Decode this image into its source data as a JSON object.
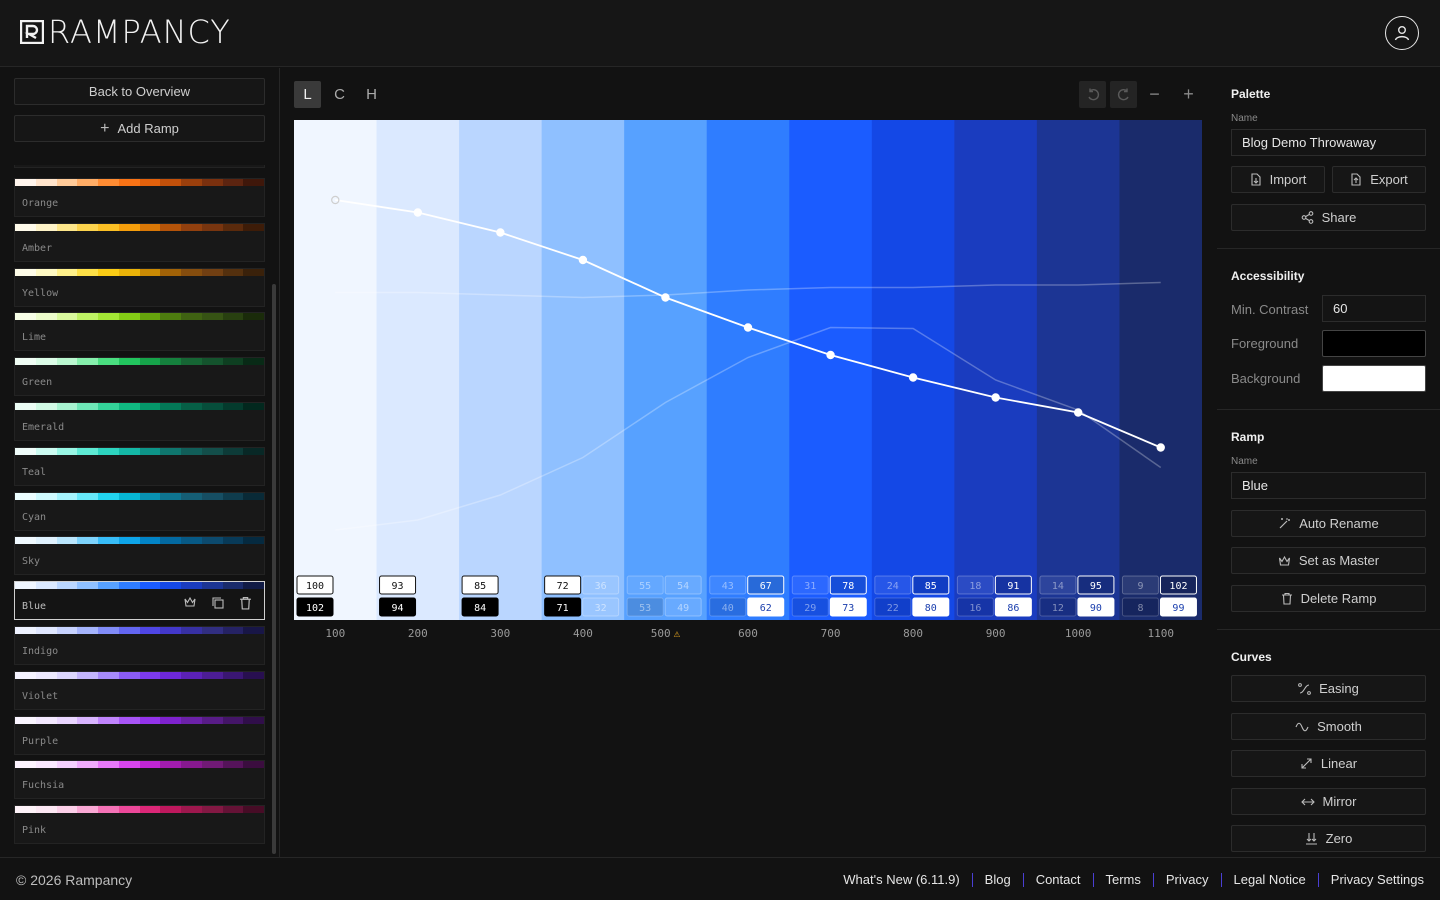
{
  "app": {
    "title": "RAMPANCY"
  },
  "nav": {
    "back_label": "Back to Overview",
    "add_label": "Add Ramp"
  },
  "ramps": [
    {
      "name": "Orange",
      "colors": [
        "#fff5ed",
        "#ffe4cc",
        "#ffcb99",
        "#ffad66",
        "#ff8c33",
        "#f97316",
        "#e2610c",
        "#c2500a",
        "#9a3f0c",
        "#7a300e",
        "#5c2410",
        "#3f170a"
      ]
    },
    {
      "name": "Amber",
      "colors": [
        "#fffbeb",
        "#fef3c7",
        "#fde68a",
        "#fcd34d",
        "#fbbf24",
        "#f59e0b",
        "#d97706",
        "#b45309",
        "#92400e",
        "#78350f",
        "#5a2a0c",
        "#3d1c08"
      ]
    },
    {
      "name": "Yellow",
      "colors": [
        "#fefce8",
        "#fef9c3",
        "#fef08a",
        "#fde047",
        "#facc15",
        "#eab308",
        "#ca8a04",
        "#a16207",
        "#854d0e",
        "#713f12",
        "#54300e",
        "#3a210a"
      ]
    },
    {
      "name": "Lime",
      "colors": [
        "#f7fee7",
        "#ecfccb",
        "#d9f99d",
        "#bef264",
        "#a3e635",
        "#84cc16",
        "#65a30d",
        "#4d7c0f",
        "#3f6212",
        "#365314",
        "#284010",
        "#1a2b0a"
      ]
    },
    {
      "name": "Green",
      "colors": [
        "#f0fdf4",
        "#dcfce7",
        "#bbf7d0",
        "#86efac",
        "#4ade80",
        "#22c55e",
        "#16a34a",
        "#15803d",
        "#166534",
        "#14532d",
        "#0e3f21",
        "#082a16"
      ]
    },
    {
      "name": "Emerald",
      "colors": [
        "#ecfdf5",
        "#d1fae5",
        "#a7f3d0",
        "#6ee7b7",
        "#34d399",
        "#10b981",
        "#059669",
        "#047857",
        "#065f46",
        "#064e3b",
        "#043b2d",
        "#02281e"
      ]
    },
    {
      "name": "Teal",
      "colors": [
        "#f0fdfa",
        "#ccfbf1",
        "#99f6e4",
        "#5eead4",
        "#2dd4bf",
        "#14b8a6",
        "#0d9488",
        "#0f766e",
        "#115e59",
        "#134e4a",
        "#0d3b38",
        "#082826"
      ]
    },
    {
      "name": "Cyan",
      "colors": [
        "#ecfeff",
        "#cffafe",
        "#a5f3fc",
        "#67e8f9",
        "#22d3ee",
        "#06b6d4",
        "#0891b2",
        "#0e7490",
        "#155e75",
        "#164e63",
        "#0f3c4d",
        "#092a37"
      ]
    },
    {
      "name": "Sky",
      "colors": [
        "#f0f9ff",
        "#e0f2fe",
        "#bae6fd",
        "#7dd3fc",
        "#38bdf8",
        "#0ea5e9",
        "#0284c7",
        "#0369a1",
        "#075985",
        "#0c4a6e",
        "#083a58",
        "#052a40"
      ]
    },
    {
      "name": "Blue",
      "colors": [
        "#f0f6ff",
        "#dbe9ff",
        "#bad6ff",
        "#8fc0ff",
        "#57a1ff",
        "#2f7dff",
        "#1b5cff",
        "#1448e6",
        "#1a3cbf",
        "#1c3594",
        "#1a2b6b",
        "#111b45"
      ]
    },
    {
      "name": "Indigo",
      "colors": [
        "#eef2ff",
        "#e0e7ff",
        "#c7d2fe",
        "#a5b4fc",
        "#818cf8",
        "#6366f1",
        "#4f46e5",
        "#4338ca",
        "#3730a3",
        "#312e81",
        "#252264",
        "#181647"
      ]
    },
    {
      "name": "Violet",
      "colors": [
        "#f5f3ff",
        "#ede9fe",
        "#ddd6fe",
        "#c4b5fd",
        "#a78bfa",
        "#8b5cf6",
        "#7c3aed",
        "#6d28d9",
        "#5b21b6",
        "#4c1d95",
        "#3a1673",
        "#280f50"
      ]
    },
    {
      "name": "Purple",
      "colors": [
        "#faf5ff",
        "#f3e8ff",
        "#e9d5ff",
        "#d8b4fe",
        "#c084fc",
        "#a855f7",
        "#9333ea",
        "#7e22ce",
        "#6b21a8",
        "#581c87",
        "#441568",
        "#300e4a"
      ]
    },
    {
      "name": "Fuchsia",
      "colors": [
        "#fdf4ff",
        "#fae8ff",
        "#f5d0fe",
        "#f0abfc",
        "#e879f9",
        "#d946ef",
        "#c026d3",
        "#a21caf",
        "#86198f",
        "#701a75",
        "#55135a",
        "#3b0d3f"
      ]
    },
    {
      "name": "Pink",
      "colors": [
        "#fdf2f8",
        "#fce7f3",
        "#fbcfe8",
        "#f9a8d4",
        "#f472b6",
        "#ec4899",
        "#db2777",
        "#be185d",
        "#9d174d",
        "#831843",
        "#651236",
        "#470c26"
      ]
    }
  ],
  "modes": {
    "l": "L",
    "c": "C",
    "h": "H"
  },
  "chart_data": {
    "type": "line",
    "x": [
      "100",
      "200",
      "300",
      "400",
      "500",
      "600",
      "700",
      "800",
      "900",
      "1000",
      "1100"
    ],
    "warning_step": "500",
    "columns": [
      "#f0f6ff",
      "#dbe9ff",
      "#bad6ff",
      "#8fc0ff",
      "#57a1ff",
      "#2f7dff",
      "#1b5cff",
      "#1448e6",
      "#1a3cbf",
      "#1c3594",
      "#1a2b6b"
    ],
    "series": [
      {
        "values": [
          84,
          81.5,
          77.5,
          72,
          64.5,
          58.5,
          53,
          48.5,
          44.5,
          41.5,
          34.5
        ]
      },
      {
        "values": [
          65.5,
          65.5,
          65,
          64.5,
          65,
          66,
          66.5,
          66.5,
          67,
          67,
          67.5
        ]
      },
      {
        "values": [
          18,
          20,
          25,
          32.5,
          43.5,
          52.5,
          58.5,
          58.3,
          48,
          42,
          30.5
        ]
      }
    ],
    "contrast_top": [
      [
        "100",
        ""
      ],
      [
        "93",
        ""
      ],
      [
        "85",
        ""
      ],
      [
        "72",
        "36"
      ],
      [
        "55",
        "54"
      ],
      [
        "43",
        "67"
      ],
      [
        "31",
        "78"
      ],
      [
        "24",
        "85"
      ],
      [
        "18",
        "91"
      ],
      [
        "14",
        "95"
      ],
      [
        "9",
        "102"
      ]
    ],
    "contrast_bottom": [
      [
        "102",
        ""
      ],
      [
        "94",
        ""
      ],
      [
        "84",
        ""
      ],
      [
        "71",
        "32"
      ],
      [
        "53",
        "49"
      ],
      [
        "40",
        "62"
      ],
      [
        "29",
        "73"
      ],
      [
        "22",
        "80"
      ],
      [
        "16",
        "86"
      ],
      [
        "12",
        "90"
      ],
      [
        "8",
        "99"
      ]
    ]
  },
  "palette": {
    "heading": "Palette",
    "name_label": "Name",
    "name_value": "Blog Demo Throwaway",
    "import_label": "Import",
    "export_label": "Export",
    "share_label": "Share"
  },
  "accessibility": {
    "heading": "Accessibility",
    "min_contrast_label": "Min. Contrast",
    "min_contrast_value": "60",
    "foreground_label": "Foreground",
    "foreground_color": "#000000",
    "background_label": "Background",
    "background_color": "#ffffff"
  },
  "ramp_panel": {
    "heading": "Ramp",
    "name_label": "Name",
    "name_value": "Blue",
    "auto_rename": "Auto Rename",
    "set_master": "Set as Master",
    "delete": "Delete Ramp"
  },
  "curves": {
    "heading": "Curves",
    "easing": "Easing",
    "smooth": "Smooth",
    "linear": "Linear",
    "mirror": "Mirror",
    "zero": "Zero"
  },
  "footer": {
    "copyright": "© 2026 Rampancy",
    "links": [
      "What's New (6.11.9)",
      "Blog",
      "Contact",
      "Terms",
      "Privacy",
      "Legal Notice",
      "Privacy Settings"
    ]
  }
}
